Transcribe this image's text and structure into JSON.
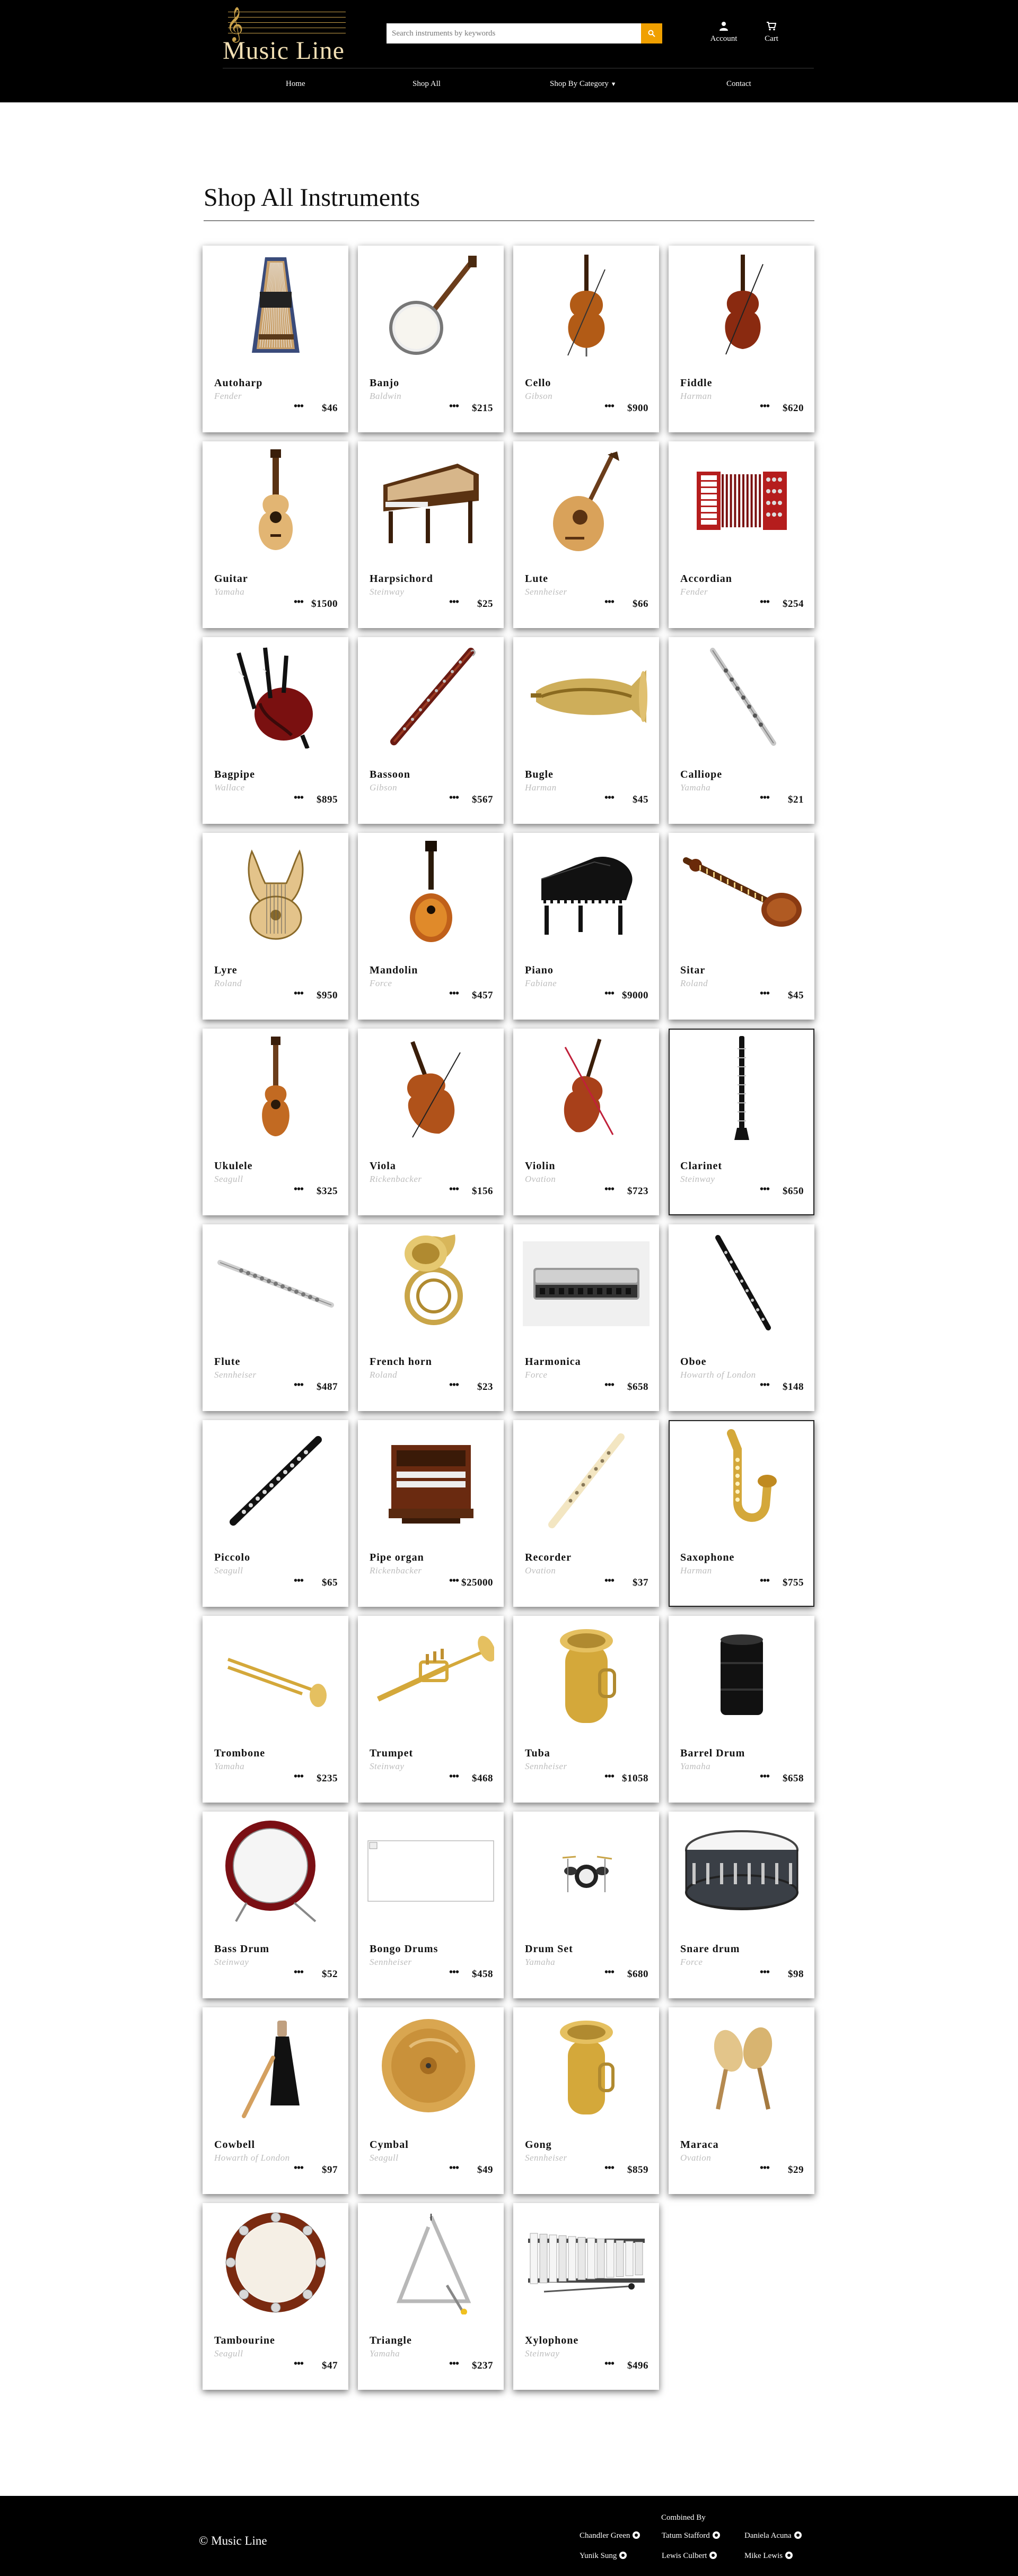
{
  "header": {
    "logo_text": "Music Line",
    "search_placeholder": "Search instruments by keywords",
    "account_label": "Account",
    "cart_label": "Cart"
  },
  "nav": {
    "home": "Home",
    "shop_all": "Shop All",
    "shop_by_category": "Shop By Category",
    "contact": "Contact"
  },
  "page": {
    "title": "Shop All Instruments"
  },
  "products": [
    {
      "name": "Autoharp",
      "brand": "Fender",
      "price": "$46",
      "icon": "autoharp-image"
    },
    {
      "name": "Banjo",
      "brand": "Baldwin",
      "price": "$215",
      "icon": "banjo-image"
    },
    {
      "name": "Cello",
      "brand": "Gibson",
      "price": "$900",
      "icon": "cello-image"
    },
    {
      "name": "Fiddle",
      "brand": "Harman",
      "price": "$620",
      "icon": "fiddle-image"
    },
    {
      "name": "Guitar",
      "brand": "Yamaha",
      "price": "$1500",
      "icon": "guitar-image"
    },
    {
      "name": "Harpsichord",
      "brand": "Steinway",
      "price": "$25",
      "icon": "harpsichord-image"
    },
    {
      "name": "Lute",
      "brand": "Sennheiser",
      "price": "$66",
      "icon": "lute-image"
    },
    {
      "name": "Accordian",
      "brand": "Fender",
      "price": "$254",
      "icon": "accordion-image"
    },
    {
      "name": "Bagpipe",
      "brand": "Wallace",
      "price": "$895",
      "icon": "bagpipe-image"
    },
    {
      "name": "Bassoon",
      "brand": "Gibson",
      "price": "$567",
      "icon": "bassoon-image"
    },
    {
      "name": "Bugle",
      "brand": "Harman",
      "price": "$45",
      "icon": "bugle-image"
    },
    {
      "name": "Calliope",
      "brand": "Yamaha",
      "price": "$21",
      "icon": "calliope-image"
    },
    {
      "name": "Lyre",
      "brand": "Roland",
      "price": "$950",
      "icon": "lyre-image"
    },
    {
      "name": "Mandolin",
      "brand": "Force",
      "price": "$457",
      "icon": "mandolin-image"
    },
    {
      "name": "Piano",
      "brand": "Fabiane",
      "price": "$9000",
      "icon": "piano-image"
    },
    {
      "name": "Sitar",
      "brand": "Roland",
      "price": "$45",
      "icon": "sitar-image"
    },
    {
      "name": "Ukulele",
      "brand": "Seagull",
      "price": "$325",
      "icon": "ukulele-image"
    },
    {
      "name": "Viola",
      "brand": "Rickenbacker",
      "price": "$156",
      "icon": "viola-image"
    },
    {
      "name": "Violin",
      "brand": "Ovation",
      "price": "$723",
      "icon": "violin-image"
    },
    {
      "name": "Clarinet",
      "brand": "Steinway",
      "price": "$650",
      "icon": "clarinet-image",
      "outlined": true
    },
    {
      "name": "Flute",
      "brand": "Sennheiser",
      "price": "$487",
      "icon": "flute-image"
    },
    {
      "name": "French horn",
      "brand": "Roland",
      "price": "$23",
      "icon": "french-horn-image"
    },
    {
      "name": "Harmonica",
      "brand": "Force",
      "price": "$658",
      "icon": "harmonica-image"
    },
    {
      "name": "Oboe",
      "brand": "Howarth of London",
      "price": "$148",
      "icon": "oboe-image"
    },
    {
      "name": "Piccolo",
      "brand": "Seagull",
      "price": "$65",
      "icon": "piccolo-image"
    },
    {
      "name": "Pipe organ",
      "brand": "Rickenbacker",
      "price": "$25000",
      "icon": "pipe-organ-image"
    },
    {
      "name": "Recorder",
      "brand": "Ovation",
      "price": "$37",
      "icon": "recorder-image"
    },
    {
      "name": "Saxophone",
      "brand": "Harman",
      "price": "$755",
      "icon": "saxophone-image",
      "outlined": true
    },
    {
      "name": "Trombone",
      "brand": "Yamaha",
      "price": "$235",
      "icon": "trombone-image"
    },
    {
      "name": "Trumpet",
      "brand": "Steinway",
      "price": "$468",
      "icon": "trumpet-image"
    },
    {
      "name": "Tuba",
      "brand": "Sennheiser",
      "price": "$1058",
      "icon": "tuba-image"
    },
    {
      "name": "Barrel Drum",
      "brand": "Yamaha",
      "price": "$658",
      "icon": "barrel-drum-image"
    },
    {
      "name": "Bass Drum",
      "brand": "Steinway",
      "price": "$52",
      "icon": "bass-drum-image"
    },
    {
      "name": "Bongo Drums",
      "brand": "Sennheiser",
      "price": "$458",
      "icon": "broken-image"
    },
    {
      "name": "Drum Set",
      "brand": "Yamaha",
      "price": "$680",
      "icon": "drum-set-image"
    },
    {
      "name": "Snare drum",
      "brand": "Force",
      "price": "$98",
      "icon": "snare-drum-image"
    },
    {
      "name": "Cowbell",
      "brand": "Howarth of London",
      "price": "$97",
      "icon": "cowbell-image"
    },
    {
      "name": "Cymbal",
      "brand": "Seagull",
      "price": "$49",
      "icon": "cymbal-image"
    },
    {
      "name": "Gong",
      "brand": "Sennheiser",
      "price": "$859",
      "icon": "gong-image"
    },
    {
      "name": "Maraca",
      "brand": "Ovation",
      "price": "$29",
      "icon": "maraca-image"
    },
    {
      "name": "Tambourine",
      "brand": "Seagull",
      "price": "$47",
      "icon": "tambourine-image"
    },
    {
      "name": "Triangle",
      "brand": "Yamaha",
      "price": "$237",
      "icon": "triangle-image"
    },
    {
      "name": "Xylophone",
      "brand": "Steinway",
      "price": "$496",
      "icon": "xylophone-image"
    }
  ],
  "card_more_glyph": "•••",
  "footer": {
    "copyright": "© Music Line",
    "combined_by": "Combined By",
    "contributors": [
      "Chandler Green",
      "Tatum Stafford",
      "Daniela Acuna",
      "Yunik Sung",
      "Lewis Culbert",
      "Mike Lewis"
    ]
  },
  "colors": {
    "header_bg": "#000000",
    "search_button": "#f0a000",
    "logo_gold": "#c9a14a"
  }
}
